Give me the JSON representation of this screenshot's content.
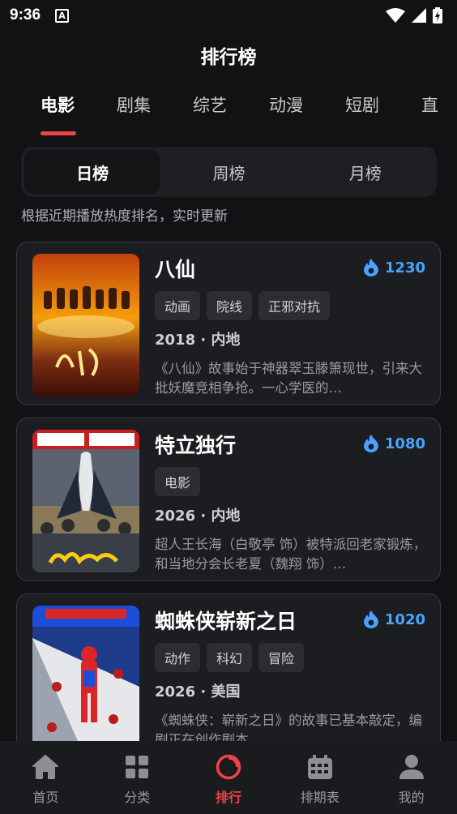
{
  "status_bar": {
    "time": "9:36",
    "notif_letter": "A"
  },
  "header": {
    "title": "排行榜"
  },
  "tabs": [
    {
      "label": "电影",
      "active": true
    },
    {
      "label": "剧集"
    },
    {
      "label": "综艺"
    },
    {
      "label": "动漫"
    },
    {
      "label": "短剧"
    },
    {
      "label": "直"
    }
  ],
  "segments": [
    {
      "label": "日榜",
      "active": true
    },
    {
      "label": "周榜"
    },
    {
      "label": "月榜"
    }
  ],
  "subtitle": "根据近期播放热度排名，实时更新",
  "accent_color": "#ef4444",
  "heat_color": "#4aa3ff",
  "items": [
    {
      "title": "八仙",
      "heat": "1230",
      "tags": [
        "动画",
        "院线",
        "正邪对抗"
      ],
      "meta": "2018 · 内地",
      "desc": "《八仙》故事始于神器翠玉滕箫现世，引来大批妖魔竞相争抢。一心学医的…"
    },
    {
      "title": "特立独行",
      "heat": "1080",
      "tags": [
        "电影"
      ],
      "meta": "2026 · 内地",
      "desc": "超人王长海（白敬亭 饰）被特派回老家锻炼，和当地分会长老夏（魏翔 饰）…"
    },
    {
      "title": "蜘蛛侠崭新之日",
      "heat": "1020",
      "tags": [
        "动作",
        "科幻",
        "冒险"
      ],
      "meta": "2026 · 美国",
      "desc": "《蜘蛛侠：崭新之日》的故事已基本敲定，编剧正在创作剧本。"
    }
  ],
  "bottom_nav": [
    {
      "label": "首页",
      "icon": "home-icon"
    },
    {
      "label": "分类",
      "icon": "grid-icon"
    },
    {
      "label": "排行",
      "icon": "ranking-icon",
      "active": true
    },
    {
      "label": "排期表",
      "icon": "calendar-icon"
    },
    {
      "label": "我的",
      "icon": "user-icon"
    }
  ]
}
